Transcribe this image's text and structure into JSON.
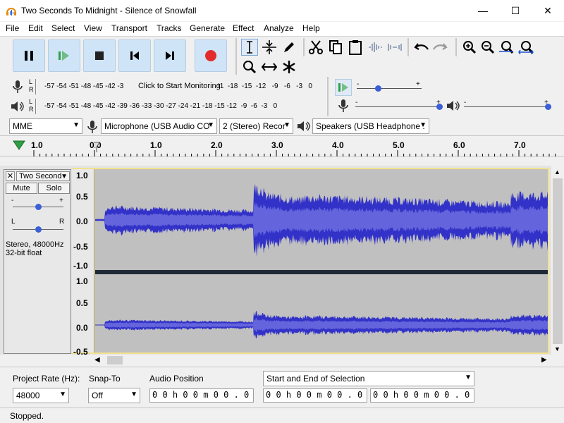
{
  "window": {
    "title": "Two Seconds To Midnight - Silence of Snowfall",
    "minimize": "—",
    "maximize": "☐",
    "close": "✕"
  },
  "menu": [
    "File",
    "Edit",
    "Select",
    "View",
    "Transport",
    "Tracks",
    "Generate",
    "Effect",
    "Analyze",
    "Help"
  ],
  "meters": {
    "record_ticks": "-57 -54 -51 -48 -45 -42 -3",
    "record_hint": "Click to Start Monitoring",
    "record_ticks_tail": "!1  -18  -15  -12   -9   -6   -3   0",
    "playback_ticks": "-57 -54 -51 -48 -45 -42 -39 -36 -33 -30 -27 -24 -21 -18 -15 -12  -9  -6  -3   0",
    "channel_l": "L",
    "channel_r": "R"
  },
  "device": {
    "host": "MME",
    "mic": "Microphone (USB Audio CO",
    "channels": "2 (Stereo) Recor",
    "speakers": "Speakers (USB Headphone ."
  },
  "ruler": [
    "1.0",
    "0.0",
    "1.0",
    "2.0",
    "3.0",
    "4.0",
    "5.0",
    "6.0",
    "7.0"
  ],
  "track": {
    "name": "Two Second",
    "mute": "Mute",
    "solo": "Solo",
    "pan_l": "L",
    "pan_r": "R",
    "gain_minus": "-",
    "gain_plus": "+",
    "info_line1": "Stereo, 48000Hz",
    "info_line2": "32-bit float",
    "scale_top": [
      "1.0",
      "0.5",
      "0.0",
      "-0.5",
      "-1.0"
    ],
    "scale_bottom": [
      "1.0",
      "0.5",
      "0.0",
      "-0.5"
    ]
  },
  "selection": {
    "project_rate_label": "Project Rate (Hz):",
    "project_rate": "48000",
    "snap_label": "Snap-To",
    "snap_value": "Off",
    "audio_pos_label": "Audio Position",
    "audio_pos": "0 0 h 0 0 m 0 0 . 0 0 0 s",
    "sel_mode": "Start and End of Selection",
    "sel_start": "0 0 h 0 0 m 0 0 . 0 0 0 s",
    "sel_end": "0 0 h 0 0 m 0 0 . 0 0 0 s"
  },
  "status": "Stopped.",
  "colors": {
    "wave": "#3232c8",
    "wave_rms": "#6464dc",
    "wave_bg": "#c0c0c0",
    "record": "#e32b2b",
    "play": "#2ea043"
  }
}
